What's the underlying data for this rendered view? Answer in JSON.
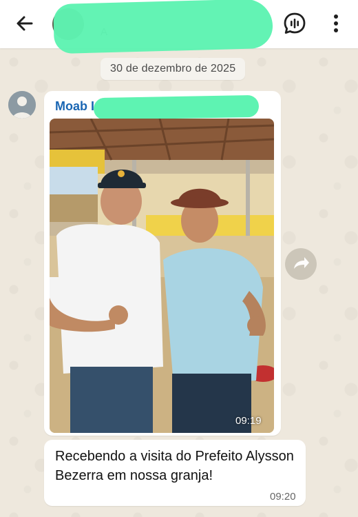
{
  "header": {
    "title": "",
    "subtitle": "A",
    "back_icon": "arrow-left-icon",
    "call_icon": "voice-call-icon",
    "menu_icon": "more-vertical-icon",
    "redaction_color": "#5ef3b2"
  },
  "date_separator": "30 de dezembro de 2025",
  "image_message": {
    "sender_name": "Moab I",
    "name_color": "#1a66b3",
    "time": "09:19"
  },
  "text_message": {
    "text": "Recebendo a visita do Prefeito Alysson Bezerra em nossa granja!",
    "time": "09:20"
  },
  "forward_icon": "forward-icon"
}
